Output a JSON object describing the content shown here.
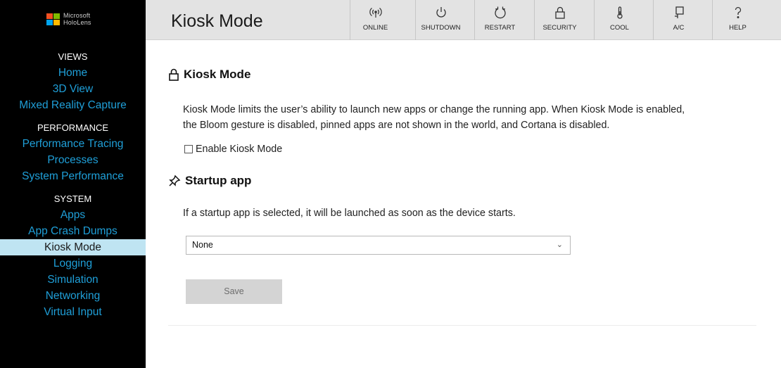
{
  "brand": {
    "logo_line1": "Microsoft",
    "logo_line2": "HoloLens",
    "logo_colors": [
      "#f25022",
      "#7fba00",
      "#00a4ef",
      "#ffb900"
    ]
  },
  "sidebar": {
    "sections": [
      {
        "header": "VIEWS",
        "items": [
          "Home",
          "3D View",
          "Mixed Reality Capture"
        ]
      },
      {
        "header": "PERFORMANCE",
        "items": [
          "Performance Tracing",
          "Processes",
          "System Performance"
        ]
      },
      {
        "header": "SYSTEM",
        "items": [
          "Apps",
          "App Crash Dumps",
          "Kiosk Mode",
          "Logging",
          "Simulation",
          "Networking",
          "Virtual Input"
        ]
      }
    ],
    "active_item": "Kiosk Mode",
    "link_color": "#1f9fd8",
    "active_bg": "#bfe4f2"
  },
  "header": {
    "title": "Kiosk Mode",
    "buttons": [
      {
        "label": "ONLINE",
        "icon": "wifi-signal-icon"
      },
      {
        "label": "SHUTDOWN",
        "icon": "power-icon"
      },
      {
        "label": "RESTART",
        "icon": "restart-icon"
      },
      {
        "label": "SECURITY",
        "icon": "lock-icon"
      },
      {
        "label": "COOL",
        "icon": "thermometer-icon"
      },
      {
        "label": "A/C",
        "icon": "plug-icon"
      },
      {
        "label": "HELP",
        "icon": "help-icon"
      }
    ]
  },
  "kiosk": {
    "title": "Kiosk Mode",
    "icon": "lock-icon",
    "description_line1": "Kiosk Mode limits the user’s ability to launch new apps or change the running app. When Kiosk Mode is enabled,",
    "description_line2": "the Bloom gesture is disabled, pinned apps are not shown in the world, and Cortana is disabled.",
    "checkbox_label": "Enable Kiosk Mode",
    "checkbox_checked": false
  },
  "startup": {
    "title": "Startup app",
    "icon": "pin-icon",
    "description": "If a startup app is selected, it will be launched as soon as the device starts.",
    "selected_value": "None",
    "save_label": "Save"
  }
}
